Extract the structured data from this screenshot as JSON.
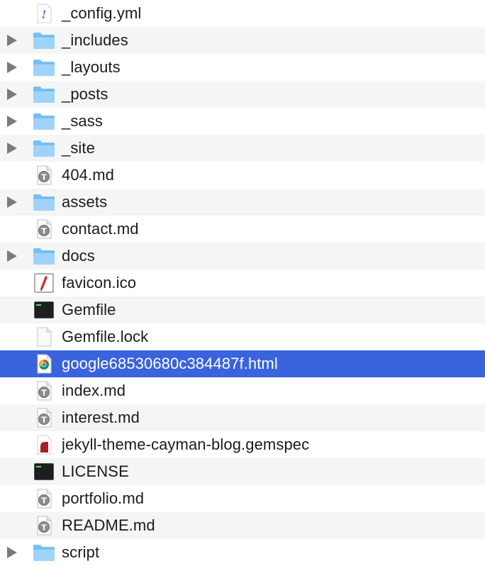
{
  "files": [
    {
      "name": "_config.yml",
      "kind": "yml",
      "folder": false,
      "icon": "yaml-file-icon"
    },
    {
      "name": "_includes",
      "kind": "folder",
      "folder": true,
      "icon": "folder-icon"
    },
    {
      "name": "_layouts",
      "kind": "folder",
      "folder": true,
      "icon": "folder-icon"
    },
    {
      "name": "_posts",
      "kind": "folder",
      "folder": true,
      "icon": "folder-icon"
    },
    {
      "name": "_sass",
      "kind": "folder",
      "folder": true,
      "icon": "folder-icon"
    },
    {
      "name": "_site",
      "kind": "folder",
      "folder": true,
      "icon": "folder-icon"
    },
    {
      "name": "404.md",
      "kind": "md",
      "folder": false,
      "icon": "markdown-file-icon"
    },
    {
      "name": "assets",
      "kind": "folder",
      "folder": true,
      "icon": "folder-icon"
    },
    {
      "name": "contact.md",
      "kind": "md",
      "folder": false,
      "icon": "markdown-file-icon"
    },
    {
      "name": "docs",
      "kind": "folder",
      "folder": true,
      "icon": "folder-icon"
    },
    {
      "name": "favicon.ico",
      "kind": "ico",
      "folder": false,
      "icon": "image-file-icon"
    },
    {
      "name": "Gemfile",
      "kind": "exec",
      "folder": false,
      "icon": "executable-file-icon"
    },
    {
      "name": "Gemfile.lock",
      "kind": "blank",
      "folder": false,
      "icon": "blank-file-icon"
    },
    {
      "name": "google68530680c384487f.html",
      "kind": "html",
      "folder": false,
      "icon": "chrome-html-file-icon",
      "selected": true
    },
    {
      "name": "index.md",
      "kind": "md",
      "folder": false,
      "icon": "markdown-file-icon"
    },
    {
      "name": "interest.md",
      "kind": "md",
      "folder": false,
      "icon": "markdown-file-icon"
    },
    {
      "name": "jekyll-theme-cayman-blog.gemspec",
      "kind": "gemspec",
      "folder": false,
      "icon": "ruby-gemspec-file-icon"
    },
    {
      "name": "LICENSE",
      "kind": "exec",
      "folder": false,
      "icon": "executable-file-icon"
    },
    {
      "name": "portfolio.md",
      "kind": "md",
      "folder": false,
      "icon": "markdown-file-icon"
    },
    {
      "name": "README.md",
      "kind": "md",
      "folder": false,
      "icon": "markdown-file-icon"
    },
    {
      "name": "script",
      "kind": "folder",
      "folder": true,
      "icon": "folder-icon"
    }
  ],
  "colors": {
    "selection": "#3a63de",
    "alt_row": "#f4f5f5",
    "folder": "#7cc3f5",
    "disclosure": "#7a7a7a"
  }
}
